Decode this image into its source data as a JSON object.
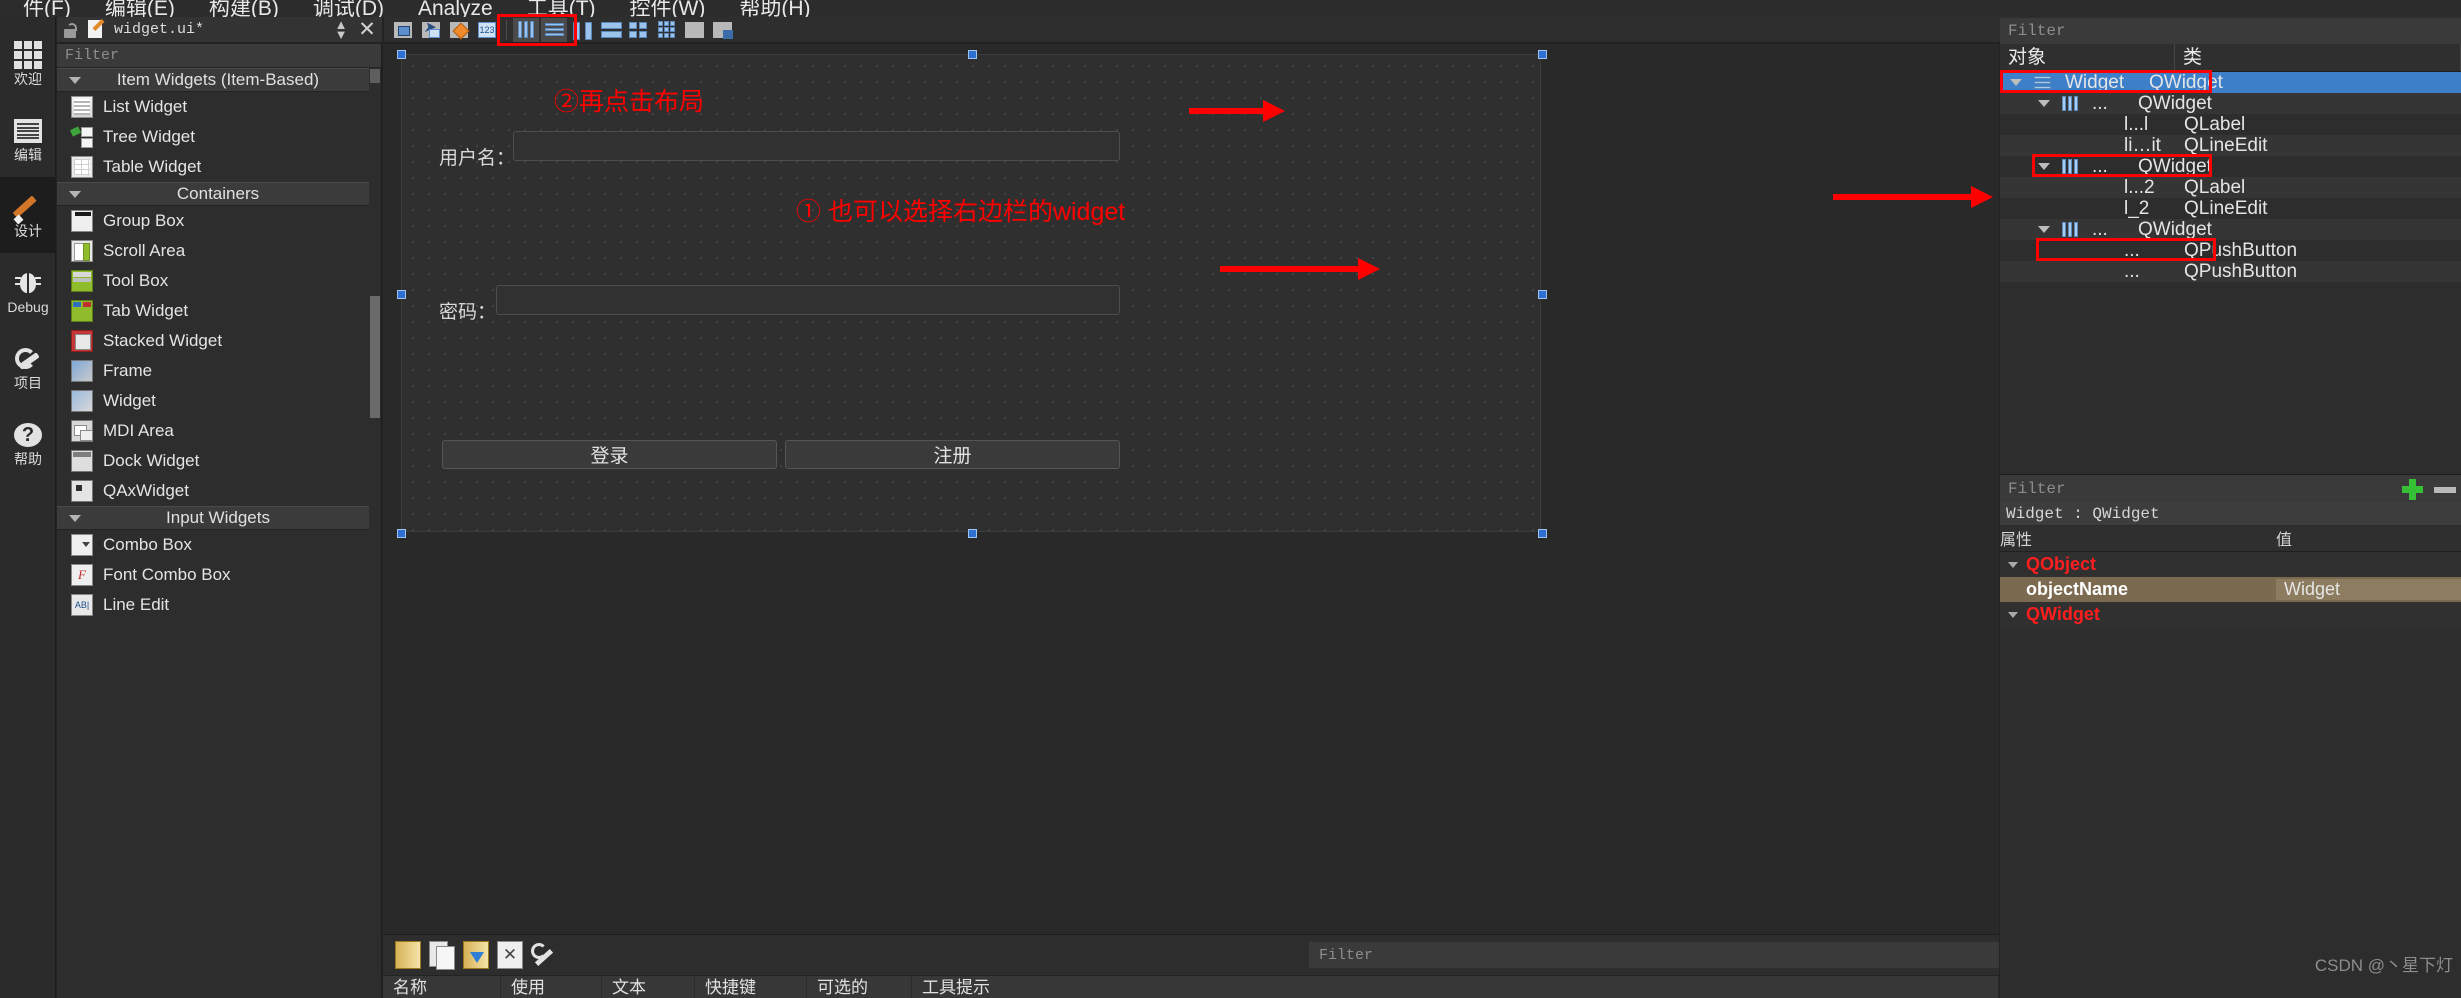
{
  "menubar": {
    "items": [
      "件(F)",
      "编辑(E)",
      "构建(B)",
      "调试(D)",
      "Analyze",
      "工具(T)",
      "控件(W)",
      "帮助(H)"
    ]
  },
  "modebar": {
    "items": [
      {
        "label": "欢迎",
        "icon": "grid-icon",
        "active": false
      },
      {
        "label": "编辑",
        "icon": "lines-icon",
        "active": false
      },
      {
        "label": "设计",
        "icon": "pencil-icon",
        "active": true
      },
      {
        "label": "Debug",
        "icon": "bug-icon",
        "active": false
      },
      {
        "label": "项目",
        "icon": "wrench-icon",
        "active": false
      },
      {
        "label": "帮助",
        "icon": "question-icon",
        "active": false
      }
    ]
  },
  "dochead": {
    "filename": "widget.ui*",
    "lock_icon": "unlock-icon",
    "file_icon": "edit-file-icon",
    "updown_icon": "updown-arrows-icon",
    "close_icon": "close-icon"
  },
  "toolbar": {
    "buttons": [
      {
        "name": "edit-widgets-button",
        "icon": "select-widget-icon",
        "selected": false
      },
      {
        "name": "edit-signals-slots-button",
        "icon": "signal-slot-icon",
        "selected": false
      },
      {
        "name": "edit-buddies-button",
        "icon": "buddy-icon",
        "selected": false
      },
      {
        "name": "edit-tab-order-button",
        "icon": "tab-order-icon",
        "selected": false
      },
      {
        "name": "layout-horizontally-button",
        "icon": "layout-horizontal-icon",
        "selected": true
      },
      {
        "name": "layout-vertically-button",
        "icon": "layout-vertical-icon",
        "selected": true
      },
      {
        "name": "layout-splitter-horizontal-button",
        "icon": "splitter-horizontal-icon",
        "selected": false
      },
      {
        "name": "layout-splitter-vertical-button",
        "icon": "splitter-vertical-icon",
        "selected": false
      },
      {
        "name": "layout-form-button",
        "icon": "layout-form-icon",
        "selected": false
      },
      {
        "name": "layout-grid-button",
        "icon": "layout-grid-icon",
        "selected": false
      },
      {
        "name": "break-layout-button",
        "icon": "break-layout-icon",
        "selected": false
      },
      {
        "name": "adjust-size-button",
        "icon": "adjust-size-icon",
        "selected": false
      }
    ],
    "highlight_color": "#fe0000"
  },
  "widgetbox": {
    "filter_placeholder": "Filter",
    "groups": [
      {
        "title": "Item Widgets (Item-Based)",
        "items": [
          {
            "label": "List Widget",
            "icon": "list-widget-icon"
          },
          {
            "label": "Tree Widget",
            "icon": "tree-widget-icon"
          },
          {
            "label": "Table Widget",
            "icon": "table-widget-icon"
          }
        ]
      },
      {
        "title": "Containers",
        "items": [
          {
            "label": "Group Box",
            "icon": "group-box-icon"
          },
          {
            "label": "Scroll Area",
            "icon": "scroll-area-icon"
          },
          {
            "label": "Tool Box",
            "icon": "tool-box-icon"
          },
          {
            "label": "Tab Widget",
            "icon": "tab-widget-icon"
          },
          {
            "label": "Stacked Widget",
            "icon": "stacked-widget-icon"
          },
          {
            "label": "Frame",
            "icon": "frame-icon"
          },
          {
            "label": "Widget",
            "icon": "widget-icon"
          },
          {
            "label": "MDI Area",
            "icon": "mdi-area-icon"
          },
          {
            "label": "Dock Widget",
            "icon": "dock-widget-icon"
          },
          {
            "label": "QAxWidget",
            "icon": "qax-widget-icon"
          }
        ]
      },
      {
        "title": "Input Widgets",
        "items": [
          {
            "label": "Combo Box",
            "icon": "combo-box-icon"
          },
          {
            "label": "Font Combo Box",
            "icon": "font-combo-box-icon"
          },
          {
            "label": "Line Edit",
            "icon": "line-edit-icon"
          }
        ]
      }
    ]
  },
  "form": {
    "username_label": "用户名：",
    "password_label": "密码：",
    "login_button": "登录",
    "register_button": "注册",
    "annotations": [
      {
        "text": "②再点击布局",
        "name": "annotation-click-layout"
      },
      {
        "text": "① 也可以选择右边栏的widget",
        "name": "annotation-select-sidebar-widget"
      }
    ]
  },
  "bottom_panel": {
    "filter_placeholder": "Filter",
    "toolbar_icons": [
      "new-icon",
      "copy-icon",
      "paste-icon",
      "delete-icon",
      "configure-icon"
    ],
    "columns": [
      "名称",
      "使用",
      "文本",
      "快捷键",
      "可选的",
      "工具提示"
    ]
  },
  "object_tree": {
    "filter_placeholder": "Filter",
    "columns": [
      "对象",
      "类"
    ],
    "rows": [
      {
        "name": "Widget",
        "cls": "QWidget",
        "depth": 0,
        "expander": true,
        "icon": "hbars-icon",
        "selected": true,
        "boxed": true
      },
      {
        "name": "...",
        "cls": "QWidget",
        "depth": 1,
        "expander": true,
        "icon": "vbars-icon",
        "selected": false,
        "boxed": false
      },
      {
        "name": "l...l",
        "cls": "QLabel",
        "depth": 2,
        "expander": false,
        "icon": "",
        "selected": false,
        "boxed": false
      },
      {
        "name": "li…it",
        "cls": "QLineEdit",
        "depth": 2,
        "expander": false,
        "icon": "",
        "selected": false,
        "boxed": false
      },
      {
        "name": "...",
        "cls": "QWidget",
        "depth": 1,
        "expander": true,
        "icon": "vbars-icon",
        "selected": false,
        "boxed": true
      },
      {
        "name": "l...2",
        "cls": "QLabel",
        "depth": 2,
        "expander": false,
        "icon": "",
        "selected": false,
        "boxed": false
      },
      {
        "name": "l_2",
        "cls": "QLineEdit",
        "depth": 2,
        "expander": false,
        "icon": "",
        "selected": false,
        "boxed": false
      },
      {
        "name": "...",
        "cls": "QWidget",
        "depth": 1,
        "expander": true,
        "icon": "vbars-icon",
        "selected": false,
        "boxed": true
      },
      {
        "name": "...",
        "cls": "QPushButton",
        "depth": 2,
        "expander": false,
        "icon": "",
        "selected": false,
        "boxed": false
      },
      {
        "name": "...",
        "cls": "QPushButton",
        "depth": 2,
        "expander": false,
        "icon": "",
        "selected": false,
        "boxed": false
      }
    ]
  },
  "property_editor": {
    "filter_placeholder": "Filter",
    "add_icon": "plus-icon",
    "remove_icon": "minus-icon",
    "object_line": "Widget : QWidget",
    "columns": [
      "属性",
      "值"
    ],
    "rows": [
      {
        "key": "QObject",
        "value": "",
        "group": true,
        "highlight": false
      },
      {
        "key": "objectName",
        "value": "Widget",
        "group": false,
        "highlight": true
      },
      {
        "key": "QWidget",
        "value": "",
        "group": true,
        "highlight": false
      }
    ],
    "watermark": "CSDN @丶星下灯"
  }
}
